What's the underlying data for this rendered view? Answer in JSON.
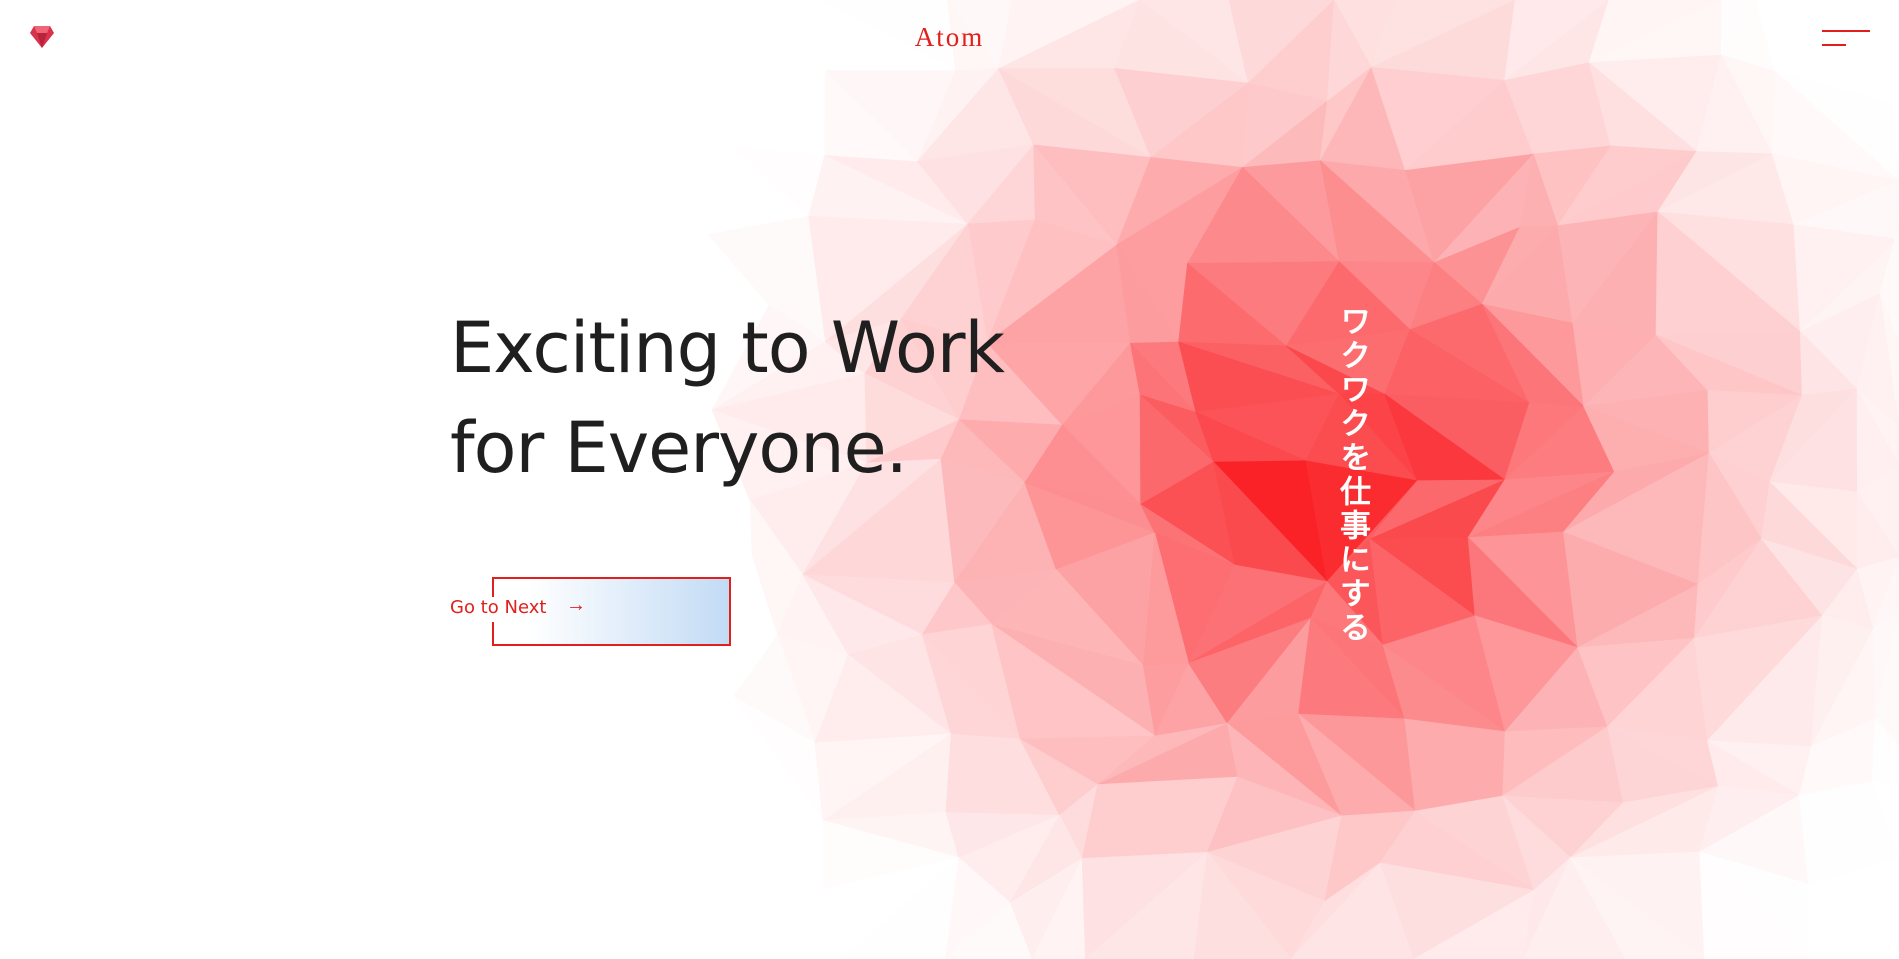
{
  "header": {
    "logo_icon": "ruby-gem-icon",
    "brand": "Atom",
    "menu_icon": "hamburger-menu-icon"
  },
  "hero": {
    "headline_line1": "Exciting to Work",
    "headline_line2": "for Everyone.",
    "vertical_text": "ワクワクを仕事にする",
    "cta_label": "Go to Next",
    "cta_arrow": "→"
  },
  "colors": {
    "accent": "#e0201c",
    "text": "#1f1f1f",
    "cta_gradient_end": "#c2dbf5"
  }
}
